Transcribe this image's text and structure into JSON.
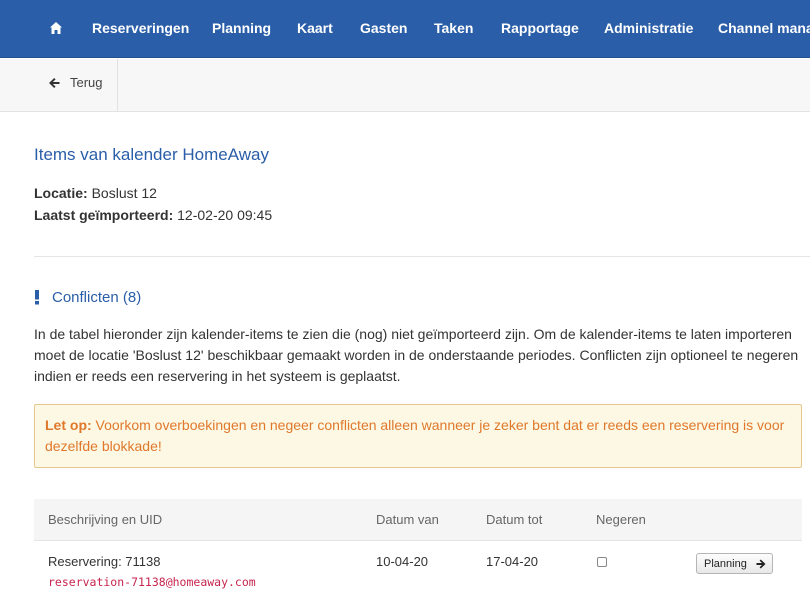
{
  "nav": {
    "home_icon": "home-icon",
    "items": [
      "Reserveringen",
      "Planning",
      "Kaart",
      "Gasten",
      "Taken",
      "Rapportage",
      "Administratie",
      "Channel manag"
    ]
  },
  "subbar": {
    "back_label": "Terug",
    "back_icon": "arrow-left-icon"
  },
  "page": {
    "title": "Items van kalender HomeAway",
    "location_label": "Locatie:",
    "location_value": "Boslust 12",
    "imported_label": "Laatst geïmporteerd:",
    "imported_value": "12-02-20 09:45"
  },
  "conflicts": {
    "heading": "Conflicten (8)",
    "intro": "In de tabel hieronder zijn kalender-items te zien die (nog) niet geïmporteerd zijn. Om de kalender-items te laten importeren moet de locatie 'Boslust 12' beschikbaar gemaakt worden in de onderstaande periodes. Conflicten zijn optioneel te negeren indien er reeds een reservering in het systeem is geplaatst.",
    "alert_label": "Let op:",
    "alert_text": "Voorkom overboekingen en negeer conflicten alleen wanneer je zeker bent dat er reeds een reservering is voor dezelfde blokkade!"
  },
  "table": {
    "headers": [
      "Beschrijving en UID",
      "Datum van",
      "Datum tot",
      "Negeren"
    ],
    "rows": [
      {
        "description": "Reservering: 71138",
        "uid": "reservation-71138@homeaway.com",
        "date_from": "10-04-20",
        "date_to": "17-04-20",
        "ignore": false,
        "action_label": "Planning"
      }
    ]
  },
  "colors": {
    "nav_bg": "#2a5ea8",
    "accent": "#2a5ea8",
    "warning_text": "#e0782c",
    "warning_bg": "#fcf8e3",
    "uid_text": "#c7254e"
  }
}
